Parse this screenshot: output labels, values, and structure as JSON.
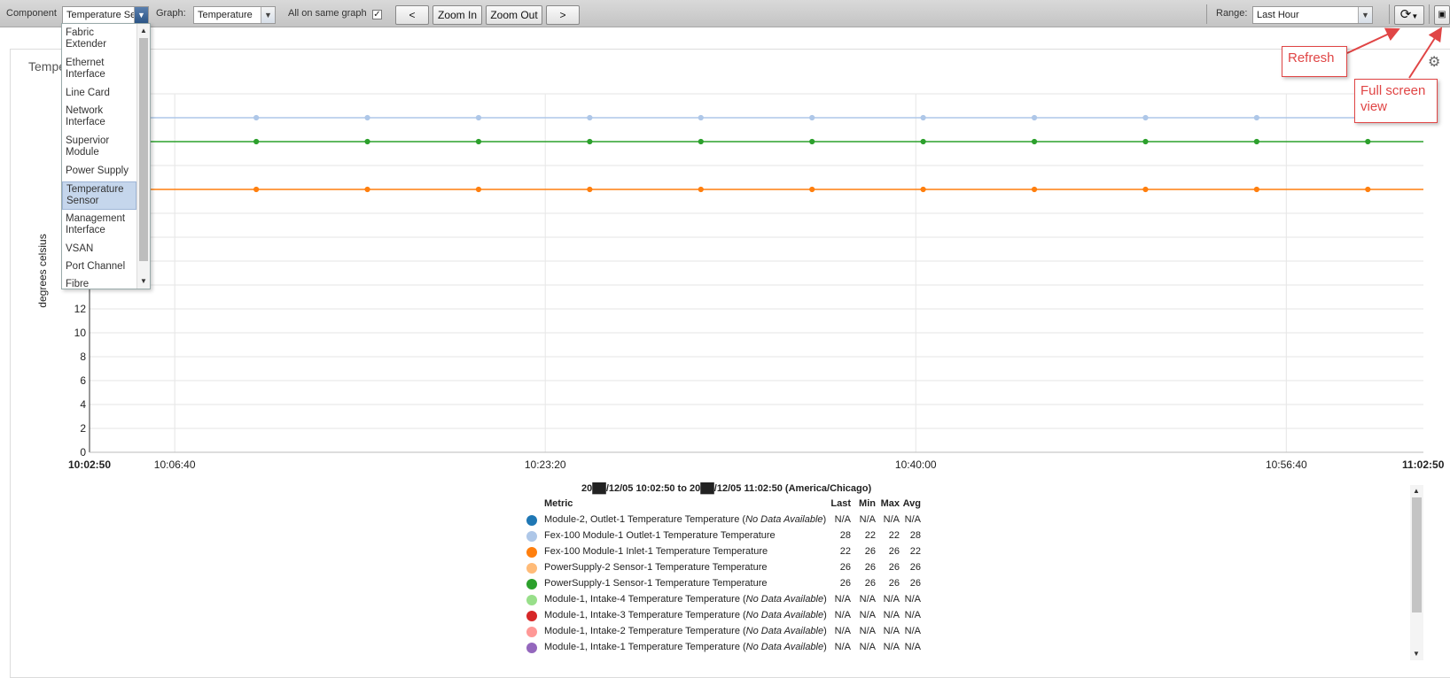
{
  "toolbar": {
    "component_label": "Component",
    "component_value": "Temperature Se",
    "graph_label": "Graph:",
    "graph_value": "Temperature",
    "all_on_same_graph_label": "All on same graph",
    "prev_label": "<",
    "zoom_in_label": "Zoom In",
    "zoom_out_label": "Zoom Out",
    "next_label": ">",
    "range_label": "Range:",
    "range_value": "Last Hour",
    "refresh_icon": "refresh-icon",
    "fullscreen_icon": "fullscreen-icon"
  },
  "dropdown": {
    "items": [
      {
        "line1": "Fabric",
        "line2": "Extender"
      },
      {
        "line1": "Ethernet",
        "line2": "Interface"
      },
      {
        "line1": "Line Card",
        "line2": ""
      },
      {
        "line1": "Network",
        "line2": "Interface"
      },
      {
        "line1": "Supervior",
        "line2": "Module"
      },
      {
        "line1": "Power Supply",
        "line2": ""
      },
      {
        "line1": "Temperature",
        "line2": "Sensor"
      },
      {
        "line1": "Management",
        "line2": "Interface"
      },
      {
        "line1": "VSAN",
        "line2": ""
      },
      {
        "line1": "Port Channel",
        "line2": ""
      },
      {
        "line1": "Fibre",
        "line2": ""
      }
    ],
    "selected_index": 6
  },
  "panel": {
    "title": "Tempe",
    "settings_icon": "gear-icon"
  },
  "chart_data": {
    "type": "line",
    "ylabel": "degrees celsius",
    "xlabel": "",
    "ylim": [
      0,
      30
    ],
    "y_ticks": [
      0,
      2,
      4,
      6,
      8,
      10,
      12
    ],
    "x_ticks": [
      "10:02:50",
      "10:06:40",
      "10:23:20",
      "10:40:00",
      "10:56:40",
      "11:02:50"
    ],
    "x_range": [
      "10:02:50",
      "11:02:50"
    ],
    "grid": true,
    "series": [
      {
        "name": "Fex-100 Module-1 Outlet-1 Temperature Temperature",
        "color": "#aec7e8",
        "value": 28
      },
      {
        "name": "PowerSupply-1 Sensor-1 Temperature Temperature",
        "color": "#2ca02c",
        "value": 26
      },
      {
        "name": "Fex-100 Module-1 Inlet-1 Temperature Temperature",
        "color": "#ff7f0e",
        "value": 22
      }
    ]
  },
  "legend": {
    "title": "20██/12/05 10:02:50 to 20██/12/05 11:02:50 (America/Chicago)",
    "headers": {
      "metric": "Metric",
      "last": "Last",
      "min": "Min",
      "max": "Max",
      "avg": "Avg"
    },
    "rows": [
      {
        "color": "#1f77b4",
        "name": "Module-2, Outlet-1 Temperature Temperature",
        "note": "No Data Available",
        "last": "N/A",
        "min": "N/A",
        "max": "N/A",
        "avg": "N/A"
      },
      {
        "color": "#aec7e8",
        "name": "Fex-100 Module-1 Outlet-1 Temperature Temperature",
        "note": "",
        "last": "28",
        "min": "22",
        "max": "22",
        "avg": "28"
      },
      {
        "color": "#ff7f0e",
        "name": "Fex-100 Module-1 Inlet-1 Temperature Temperature",
        "note": "",
        "last": "22",
        "min": "26",
        "max": "26",
        "avg": "22"
      },
      {
        "color": "#ffbb78",
        "name": "PowerSupply-2 Sensor-1 Temperature Temperature",
        "note": "",
        "last": "26",
        "min": "26",
        "max": "26",
        "avg": "26"
      },
      {
        "color": "#2ca02c",
        "name": "PowerSupply-1 Sensor-1 Temperature Temperature",
        "note": "",
        "last": "26",
        "min": "26",
        "max": "26",
        "avg": "26"
      },
      {
        "color": "#98df8a",
        "name": "Module-1, Intake-4 Temperature Temperature",
        "note": "No Data Available",
        "last": "N/A",
        "min": "N/A",
        "max": "N/A",
        "avg": "N/A"
      },
      {
        "color": "#d62728",
        "name": "Module-1, Intake-3 Temperature Temperature",
        "note": "No Data Available",
        "last": "N/A",
        "min": "N/A",
        "max": "N/A",
        "avg": "N/A"
      },
      {
        "color": "#ff9896",
        "name": "Module-1, Intake-2 Temperature Temperature",
        "note": "No Data Available",
        "last": "N/A",
        "min": "N/A",
        "max": "N/A",
        "avg": "N/A"
      },
      {
        "color": "#9467bd",
        "name": "Module-1, Intake-1 Temperature Temperature",
        "note": "No Data Available",
        "last": "N/A",
        "min": "N/A",
        "max": "N/A",
        "avg": "N/A"
      }
    ]
  },
  "annotations": {
    "refresh": "Refresh",
    "fullscreen_line1": "Full screen",
    "fullscreen_line2": "view",
    "accent": "#e04545"
  }
}
